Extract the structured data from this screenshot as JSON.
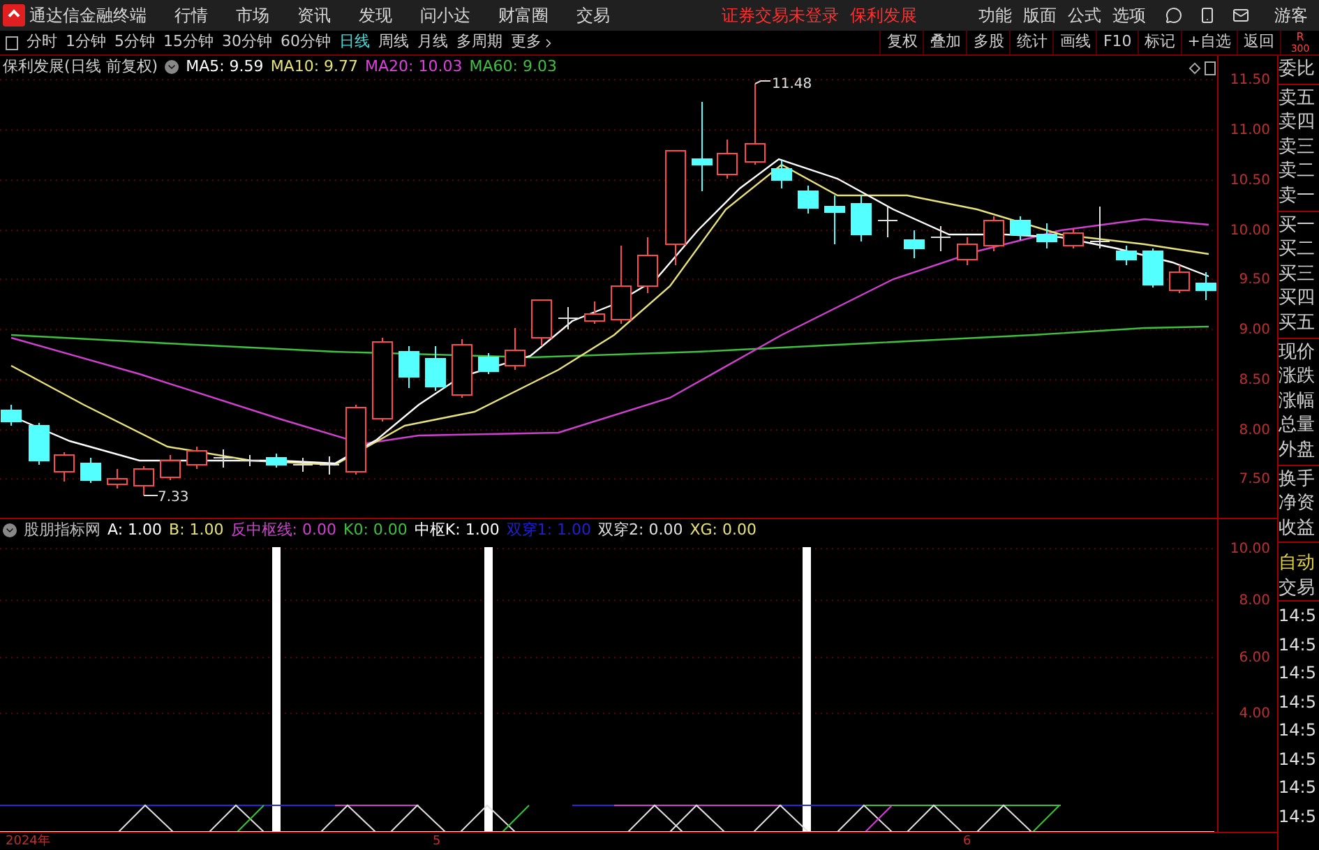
{
  "top_bar": {
    "app_title": "通达信金融终端",
    "menus": [
      "行情",
      "市场",
      "资讯",
      "发现",
      "问小达",
      "财富圈",
      "交易"
    ],
    "notice": "证券交易未登录",
    "stock_link": "保利发展",
    "right_menus": [
      "功能",
      "版面",
      "公式",
      "选项"
    ],
    "user": "游客"
  },
  "toolbar": {
    "periods": [
      {
        "label": "分时",
        "selected": false
      },
      {
        "label": "1分钟",
        "selected": false
      },
      {
        "label": "5分钟",
        "selected": false
      },
      {
        "label": "15分钟",
        "selected": false
      },
      {
        "label": "30分钟",
        "selected": false
      },
      {
        "label": "60分钟",
        "selected": false
      },
      {
        "label": "日线",
        "selected": true
      },
      {
        "label": "周线",
        "selected": false
      },
      {
        "label": "月线",
        "selected": false
      },
      {
        "label": "多周期",
        "selected": false
      }
    ],
    "more": "更多",
    "buttons": [
      "复权",
      "叠加",
      "多股",
      "统计",
      "画线",
      "F10",
      "标记",
      "+自选",
      "返回"
    ],
    "corner": [
      "R",
      "300"
    ]
  },
  "chart": {
    "title": "保利发展(日线 前复权)",
    "ma_legend": [
      {
        "label": "MA5: 9.59",
        "color": "#ffffff"
      },
      {
        "label": "MA10: 9.77",
        "color": "#e8e27a"
      },
      {
        "label": "MA20: 10.03",
        "color": "#e040e0"
      },
      {
        "label": "MA60: 9.03",
        "color": "#40c040"
      }
    ],
    "price_ticks": [
      "11.50",
      "11.00",
      "10.50",
      "10.00",
      "9.50",
      "9.00",
      "8.50",
      "8.00",
      "7.50"
    ],
    "high_label": "11.48",
    "low_label": "7.33"
  },
  "indicator": {
    "legend": [
      {
        "label": "股朋指标网",
        "color": "#c0c0c0"
      },
      {
        "label": "A: 1.00",
        "color": "#ffffff"
      },
      {
        "label": "B: 1.00",
        "color": "#e8e27a"
      },
      {
        "label": "反中枢线: 0.00",
        "color": "#d040d0"
      },
      {
        "label": "K0: 0.00",
        "color": "#40c040"
      },
      {
        "label": "中枢K: 1.00",
        "color": "#ffffff"
      },
      {
        "label": "双穿1: 1.00",
        "color": "#2020d0"
      },
      {
        "label": "双穿2: 0.00",
        "color": "#e0e0e0"
      },
      {
        "label": "XG: 0.00",
        "color": "#e8e27a"
      }
    ],
    "ticks": [
      "10.00",
      "8.00",
      "6.00",
      "4.00"
    ]
  },
  "time_axis": [
    "2024年",
    "5",
    "6"
  ],
  "side_panel": {
    "groups": [
      [
        "委比"
      ],
      [
        "卖五",
        "卖四",
        "卖三",
        "卖二",
        "卖一"
      ],
      [
        "买一",
        "买二",
        "买三",
        "买四",
        "买五"
      ],
      [
        "现价",
        "涨跌",
        "涨幅",
        "总量",
        "外盘"
      ],
      [
        "换手",
        "净资",
        "收益"
      ]
    ],
    "mode": "自动",
    "trade_label": "交易",
    "times": [
      "14:5",
      "14:5",
      "14:5",
      "14:5",
      "14:5",
      "14:5",
      "14:5",
      "14:5"
    ]
  }
}
